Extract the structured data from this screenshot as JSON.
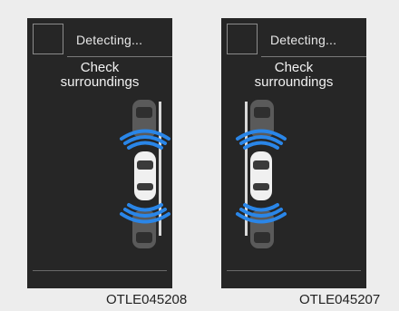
{
  "panels": [
    {
      "status": "Detecting...",
      "message_line1": "Check",
      "message_line2": "surroundings",
      "detection_side": "left",
      "figure_code": "OTLE045208"
    },
    {
      "status": "Detecting...",
      "message_line1": "Check",
      "message_line2": "surroundings",
      "detection_side": "right",
      "figure_code": "OTLE045207"
    }
  ],
  "colors": {
    "background": "#ededed",
    "display": "#262626",
    "wave": "#2a86e8",
    "text": "#f2f2f2"
  }
}
